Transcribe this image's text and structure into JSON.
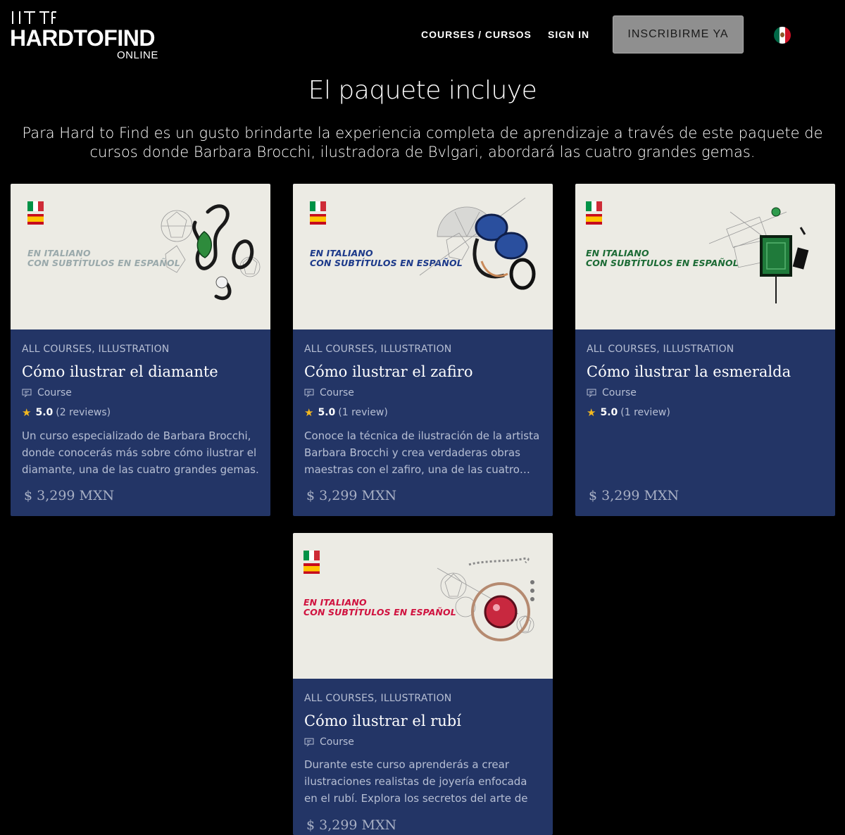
{
  "brand": {
    "mark": "HTF",
    "name": "HARDTOFIND",
    "sub": "ONLINE"
  },
  "nav": {
    "courses": "COURSES / CURSOS",
    "signin": "SIGN IN",
    "enroll": "INSCRIBIRME YA",
    "locale_flag": "mexico-flag"
  },
  "hero": {
    "title": "El paquete incluye",
    "intro": "Para Hard to Find es un gusto brindarte la experiencia completa de aprendizaje a través de este paquete de cursos donde Barbara Brocchi, ilustradora de Bvlgari, abordará las cuatro grandes gemas."
  },
  "colors": {
    "card_bg": "#233566",
    "image_bg": "#ecebe4",
    "star": "#f3b81f"
  },
  "courses": [
    {
      "banner_line1": "EN ITALIANO",
      "banner_line2": "CON SUBTÍTULOS EN ESPAÑOL",
      "banner_color": "#9aa9ab",
      "gem_color": "#2e8b3c",
      "categories": "ALL COURSES, ILLUSTRATION",
      "title": "Cómo ilustrar el diamante",
      "type": "Course",
      "rating": "5.0",
      "reviews": "(2 reviews)",
      "description": "Un curso especializado de Barbara Brocchi, donde conocerás más sobre cómo ilustrar el diamante, una de las cuatro grandes gemas.",
      "price": "$ 3,299 MXN"
    },
    {
      "banner_line1": "EN ITALIANO",
      "banner_line2": "CON SUBTÍTULOS EN ESPAÑOL",
      "banner_color": "#1d3a8a",
      "gem_color": "#2a4f9e",
      "categories": "ALL COURSES, ILLUSTRATION",
      "title": "Cómo ilustrar el zafiro",
      "type": "Course",
      "rating": "5.0",
      "reviews": "(1 review)",
      "description": "Conoce la técnica de ilustración de la artista Barbara Brocchi y crea verdaderas obras maestras con el zafiro, una de las cuatro…",
      "price": "$ 3,299 MXN"
    },
    {
      "banner_line1": "EN ITALIANO",
      "banner_line2": "CON SUBTÍTULOS EN ESPAÑOL",
      "banner_color": "#1c6b35",
      "gem_color": "#1f7a3a",
      "categories": "ALL COURSES, ILLUSTRATION",
      "title": "Cómo ilustrar la esmeralda",
      "type": "Course",
      "rating": "5.0",
      "reviews": "(1 review)",
      "description": "",
      "price": "$ 3,299 MXN"
    },
    {
      "banner_line1": "EN ITALIANO",
      "banner_line2": "CON SUBTÍTULOS EN ESPAÑOL",
      "banner_color": "#d0123f",
      "gem_color": "#c8283f",
      "categories": "ALL COURSES, ILLUSTRATION",
      "title": "Cómo ilustrar el rubí",
      "type": "Course",
      "rating": "",
      "reviews": "",
      "description": "Durante este curso aprenderás a crear ilustraciones realistas de joyería enfocada en el rubí. Explora los secretos del arte de la…",
      "price": "$ 3,299 MXN"
    }
  ]
}
